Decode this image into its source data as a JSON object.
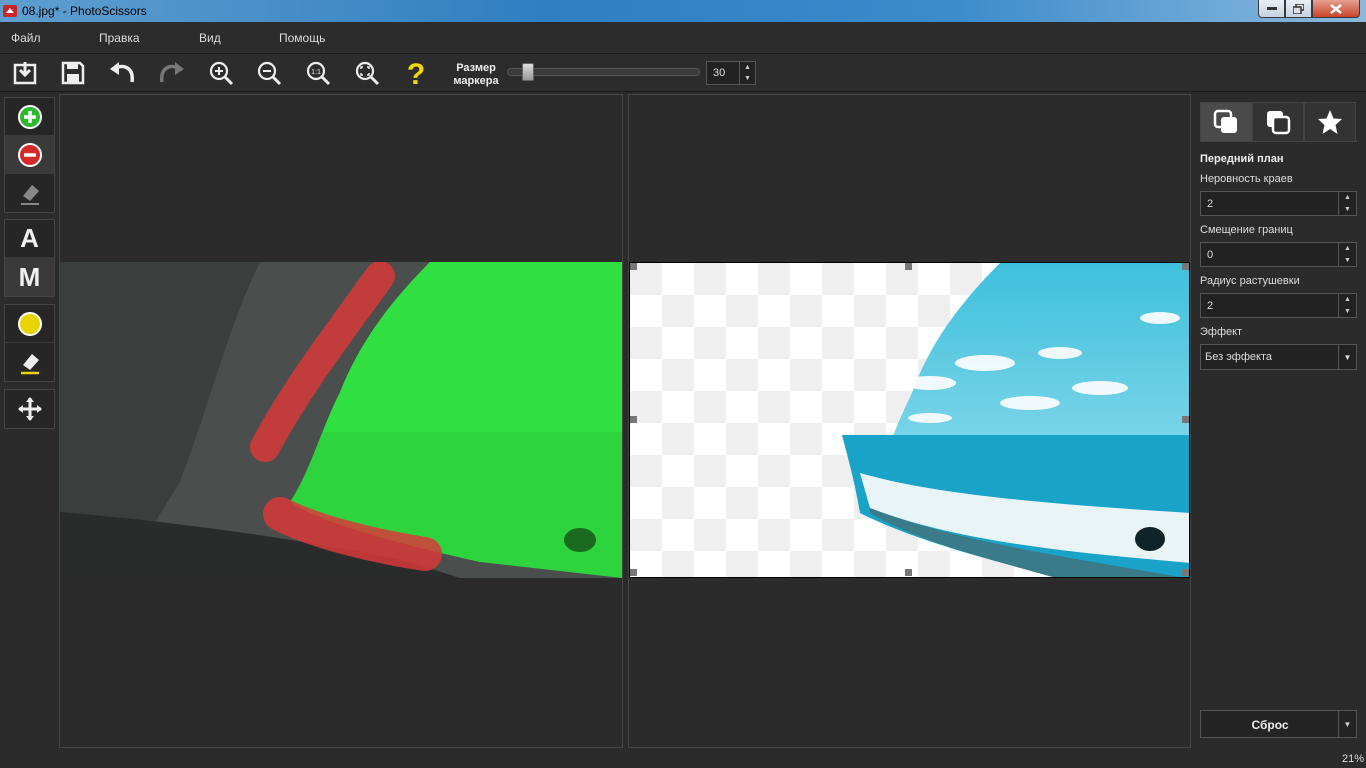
{
  "window": {
    "title": "08.jpg* - PhotoScissors"
  },
  "menu": [
    {
      "label": "Файл"
    },
    {
      "label": "Правка"
    },
    {
      "label": "Вид"
    },
    {
      "label": "Помощь"
    }
  ],
  "toolbar": {
    "marker_label_line1": "Размер",
    "marker_label_line2": "маркера",
    "marker_size": "30",
    "marker_fraction": 0.12,
    "buttons": [
      "open-icon",
      "save-icon",
      "undo-icon",
      "redo-icon",
      "zoom-in-icon",
      "zoom-out-icon",
      "zoom-actual-icon",
      "zoom-fit-icon",
      "help-icon"
    ]
  },
  "tools": {
    "foreground_marker": "plus-circle-icon",
    "background_marker": "minus-circle-icon",
    "eraser": "eraser-icon",
    "auto_mode": "A",
    "manual_mode": "M",
    "color_marker": "yellow-circle-icon",
    "color_eraser": "eraser-icon",
    "move": "move-icon"
  },
  "right_panel": {
    "tabs": [
      "foreground-tab-icon",
      "background-tab-icon",
      "effects-tab-icon"
    ],
    "section_title": "Передний план",
    "edge_roughness_label": "Неровность краев",
    "edge_roughness": "2",
    "border_offset_label": "Смещение границ",
    "border_offset": "0",
    "feather_radius_label": "Радиус растушевки",
    "feather_radius": "2",
    "effect_label": "Эффект",
    "effect_value": "Без эффекта",
    "reset_label": "Сброс"
  },
  "status": {
    "zoom": "21%"
  },
  "colors": {
    "accent": "#2f7fc1",
    "foreground_mask": "#22e04a",
    "background_mask": "#d83a3a",
    "help": "#f5d800"
  }
}
